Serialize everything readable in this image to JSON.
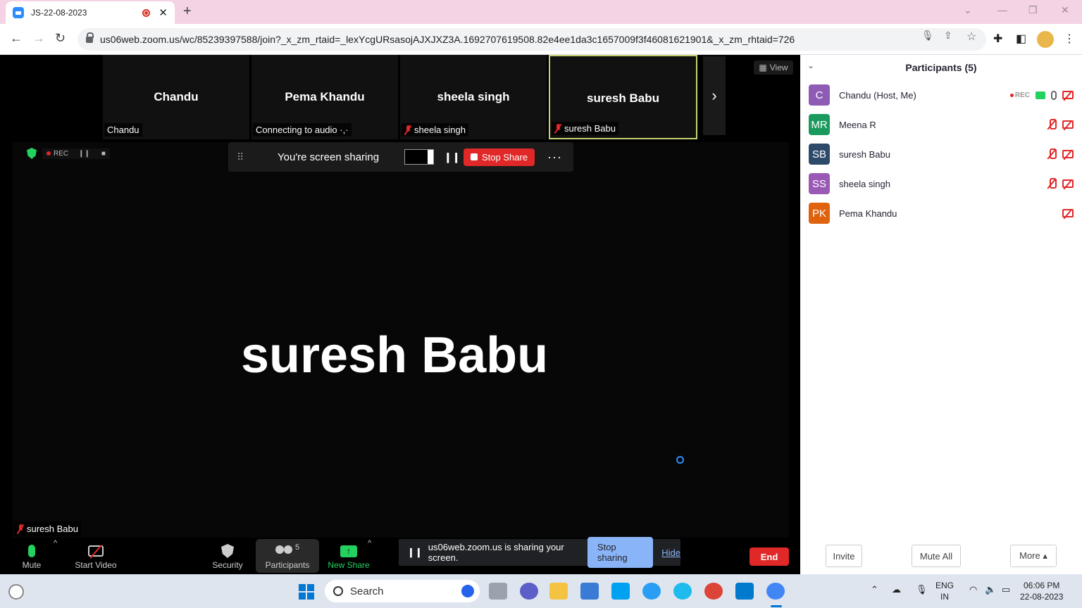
{
  "browser": {
    "tab_title": "JS-22-08-2023",
    "url": "us06web.zoom.us/wc/85239397588/join?_x_zm_rtaid=_lexYcgURsasojAJXJXZ3A.1692707619508.82e4ee1da3c1657009f3f46081621901&_x_zm_rhtaid=726"
  },
  "strip": {
    "tiles": [
      {
        "name": "Chandu",
        "label": "Chandu",
        "muted": false
      },
      {
        "name": "Pema Khandu",
        "label": "Connecting to audio ·,·",
        "muted": false
      },
      {
        "name": "sheela singh",
        "label": "sheela singh",
        "muted": true
      },
      {
        "name": "suresh Babu",
        "label": "suresh Babu",
        "muted": true,
        "active": true
      }
    ],
    "view_label": "View"
  },
  "main": {
    "speaker_name": "suresh Babu",
    "speaker_label": "suresh Babu",
    "rec_label": "REC"
  },
  "share_toolbar": {
    "status": "You're screen sharing",
    "stop_label": "Stop Share",
    "more": "···"
  },
  "toolbar": {
    "mute": "Mute",
    "start_video": "Start Video",
    "security": "Security",
    "participants": "Participants",
    "participants_count": "5",
    "new_share": "New Share",
    "end": "End"
  },
  "sharing_notice": {
    "text": "us06web.zoom.us is sharing your screen.",
    "stop": "Stop sharing",
    "hide": "Hide"
  },
  "panel": {
    "title": "Participants (5)",
    "rec_label": "REC",
    "participants": [
      {
        "initials": "C",
        "name": "Chandu (Host, Me)",
        "color": "#8e5bb5"
      },
      {
        "initials": "MR",
        "name": "Meena R",
        "color": "#1a9a5c"
      },
      {
        "initials": "SB",
        "name": "suresh Babu",
        "color": "#2e4a6b"
      },
      {
        "initials": "SS",
        "name": "sheela singh",
        "color": "#9b59b6"
      },
      {
        "initials": "PK",
        "name": "Pema Khandu",
        "color": "#e0620d"
      }
    ],
    "invite": "Invite",
    "mute_all": "Mute All",
    "more": "More ▴"
  },
  "taskbar": {
    "search": "Search",
    "lang_top": "ENG",
    "lang_bottom": "IN",
    "time": "06:06 PM",
    "date": "22-08-2023"
  }
}
